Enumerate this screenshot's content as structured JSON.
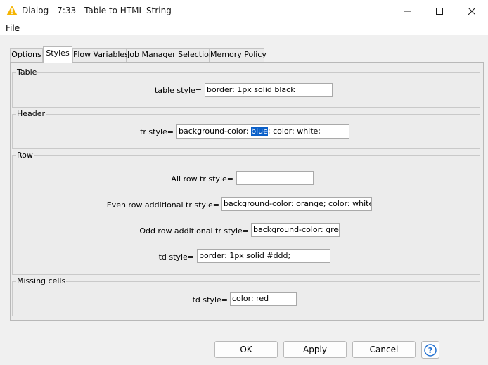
{
  "window": {
    "title": "Dialog - 7:33 - Table to HTML String",
    "minimize_icon": "minimize-icon",
    "maximize_icon": "maximize-icon",
    "close_icon": "close-icon"
  },
  "menu": {
    "file": "File"
  },
  "tabs": [
    {
      "label": "Options",
      "active": false
    },
    {
      "label": "Styles",
      "active": true
    },
    {
      "label": "Flow Variables",
      "active": false
    },
    {
      "label": "Job Manager Selection",
      "active": false
    },
    {
      "label": "Memory Policy",
      "active": false
    }
  ],
  "groups": {
    "table": {
      "title": "Table",
      "table_style_label": "table style=",
      "table_style_value": "border: 1px solid black"
    },
    "header": {
      "title": "Header",
      "tr_style_label": "tr style=",
      "tr_style_before": "background-color: ",
      "tr_style_selected": "blue",
      "tr_style_after": "; color: white;"
    },
    "row": {
      "title": "Row",
      "all_row_label": "All row tr style=",
      "all_row_value": "",
      "even_label": "Even row additional tr style=",
      "even_value": "background-color: orange; color: white;",
      "odd_label": "Odd row additional tr style=",
      "odd_value": "background-color: green;",
      "td_label": "td style=",
      "td_value": "border: 1px solid #ddd;"
    },
    "missing": {
      "title": "Missing cells",
      "td_label": "td style=",
      "td_value": "color: red"
    }
  },
  "buttons": {
    "ok": "OK",
    "apply": "Apply",
    "cancel": "Cancel",
    "help_icon": "help-icon"
  },
  "colors": {
    "selection": "#0a5fc8",
    "accent_icon": "#f5b400",
    "help_blue": "#1f6fd1"
  }
}
